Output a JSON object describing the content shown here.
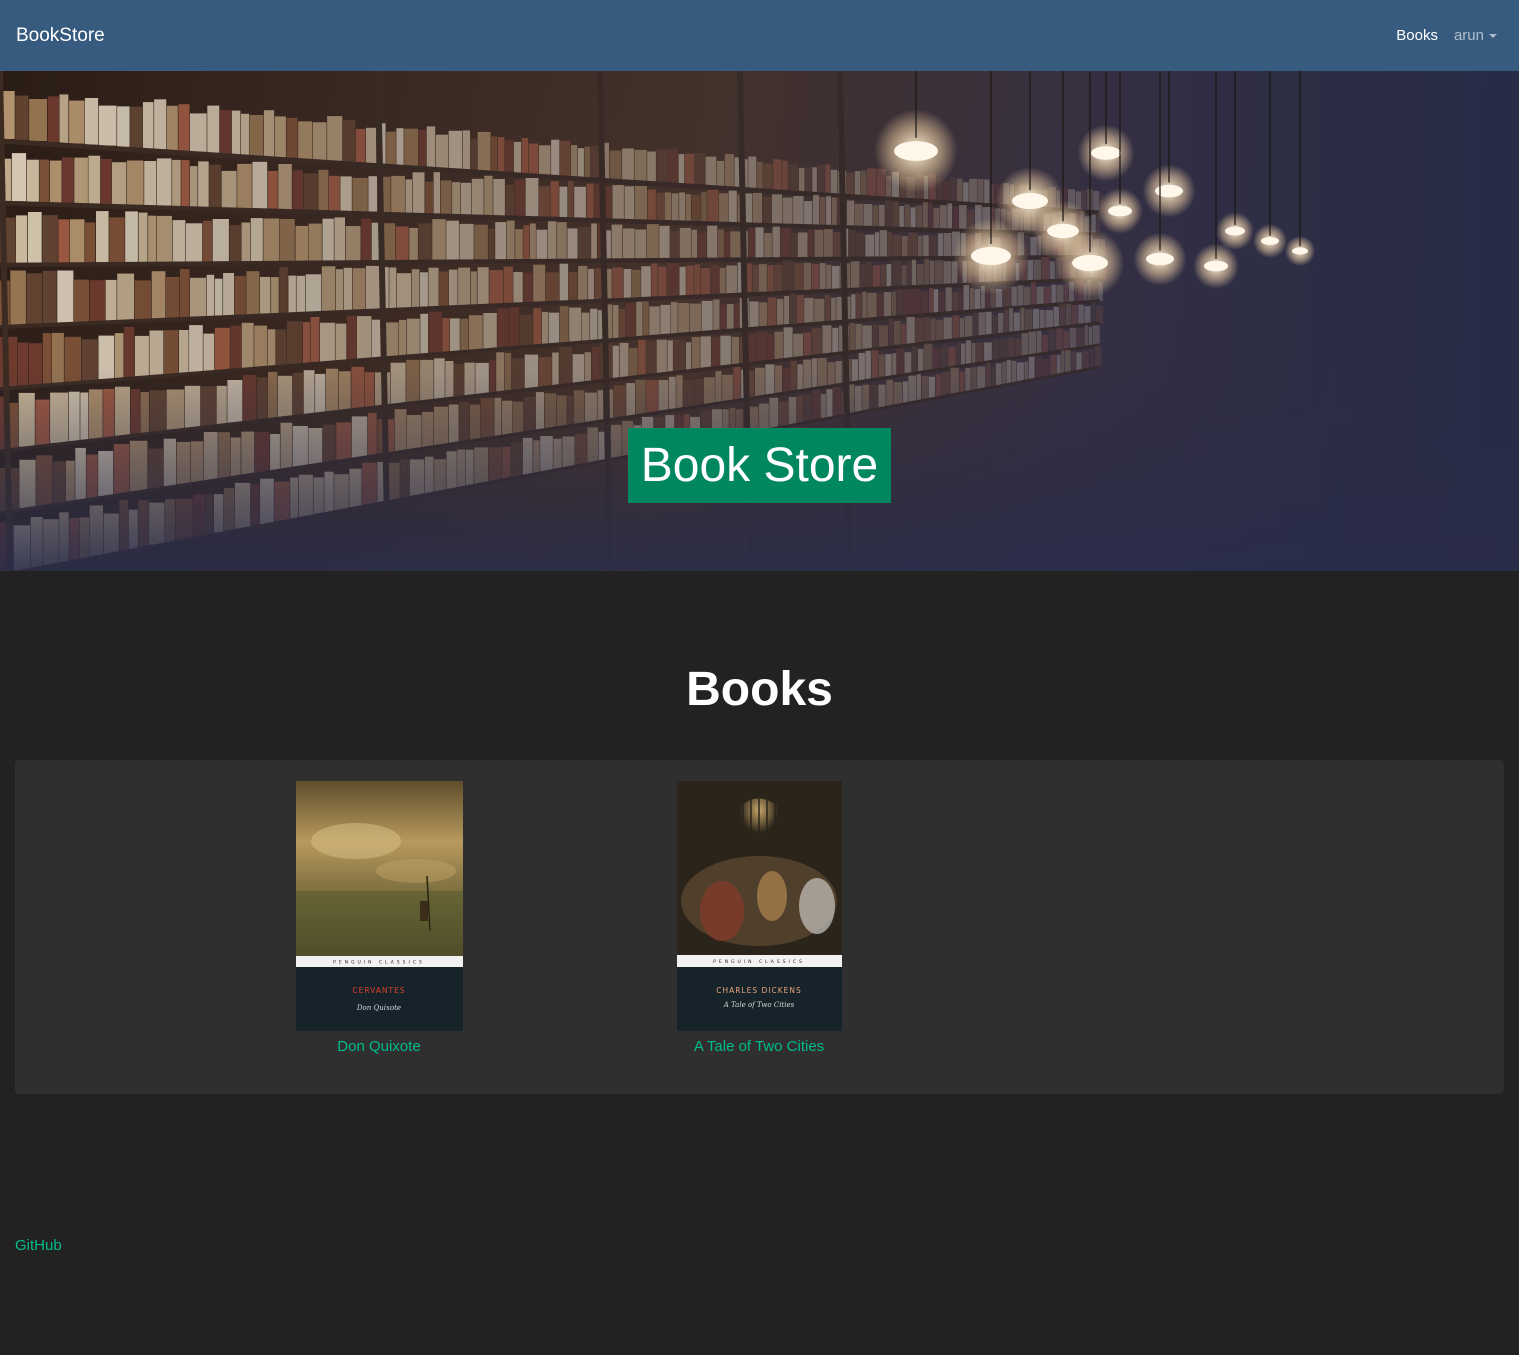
{
  "navbar": {
    "brand": "BookStore",
    "books_link": "Books",
    "user_menu": "arun"
  },
  "hero": {
    "title": "Book Store"
  },
  "books_section": {
    "title": "Books",
    "items": [
      {
        "title": "Don Quixote",
        "cover_author": "CERVANTES",
        "cover_title": "Don Quixote",
        "cover_series": "PENGUIN   CLASSICS"
      },
      {
        "title": "A Tale of Two Cities",
        "cover_author": "CHARLES DICKENS",
        "cover_title": "A Tale of Two Cities",
        "cover_series": "PENGUIN   CLASSICS"
      }
    ]
  },
  "footer": {
    "github_link": "GitHub"
  },
  "colors": {
    "navbar": "#375a7f",
    "body": "#222222",
    "panel": "#2f2f2f",
    "accent": "#00bc8c",
    "hero_badge": "#00875f"
  }
}
